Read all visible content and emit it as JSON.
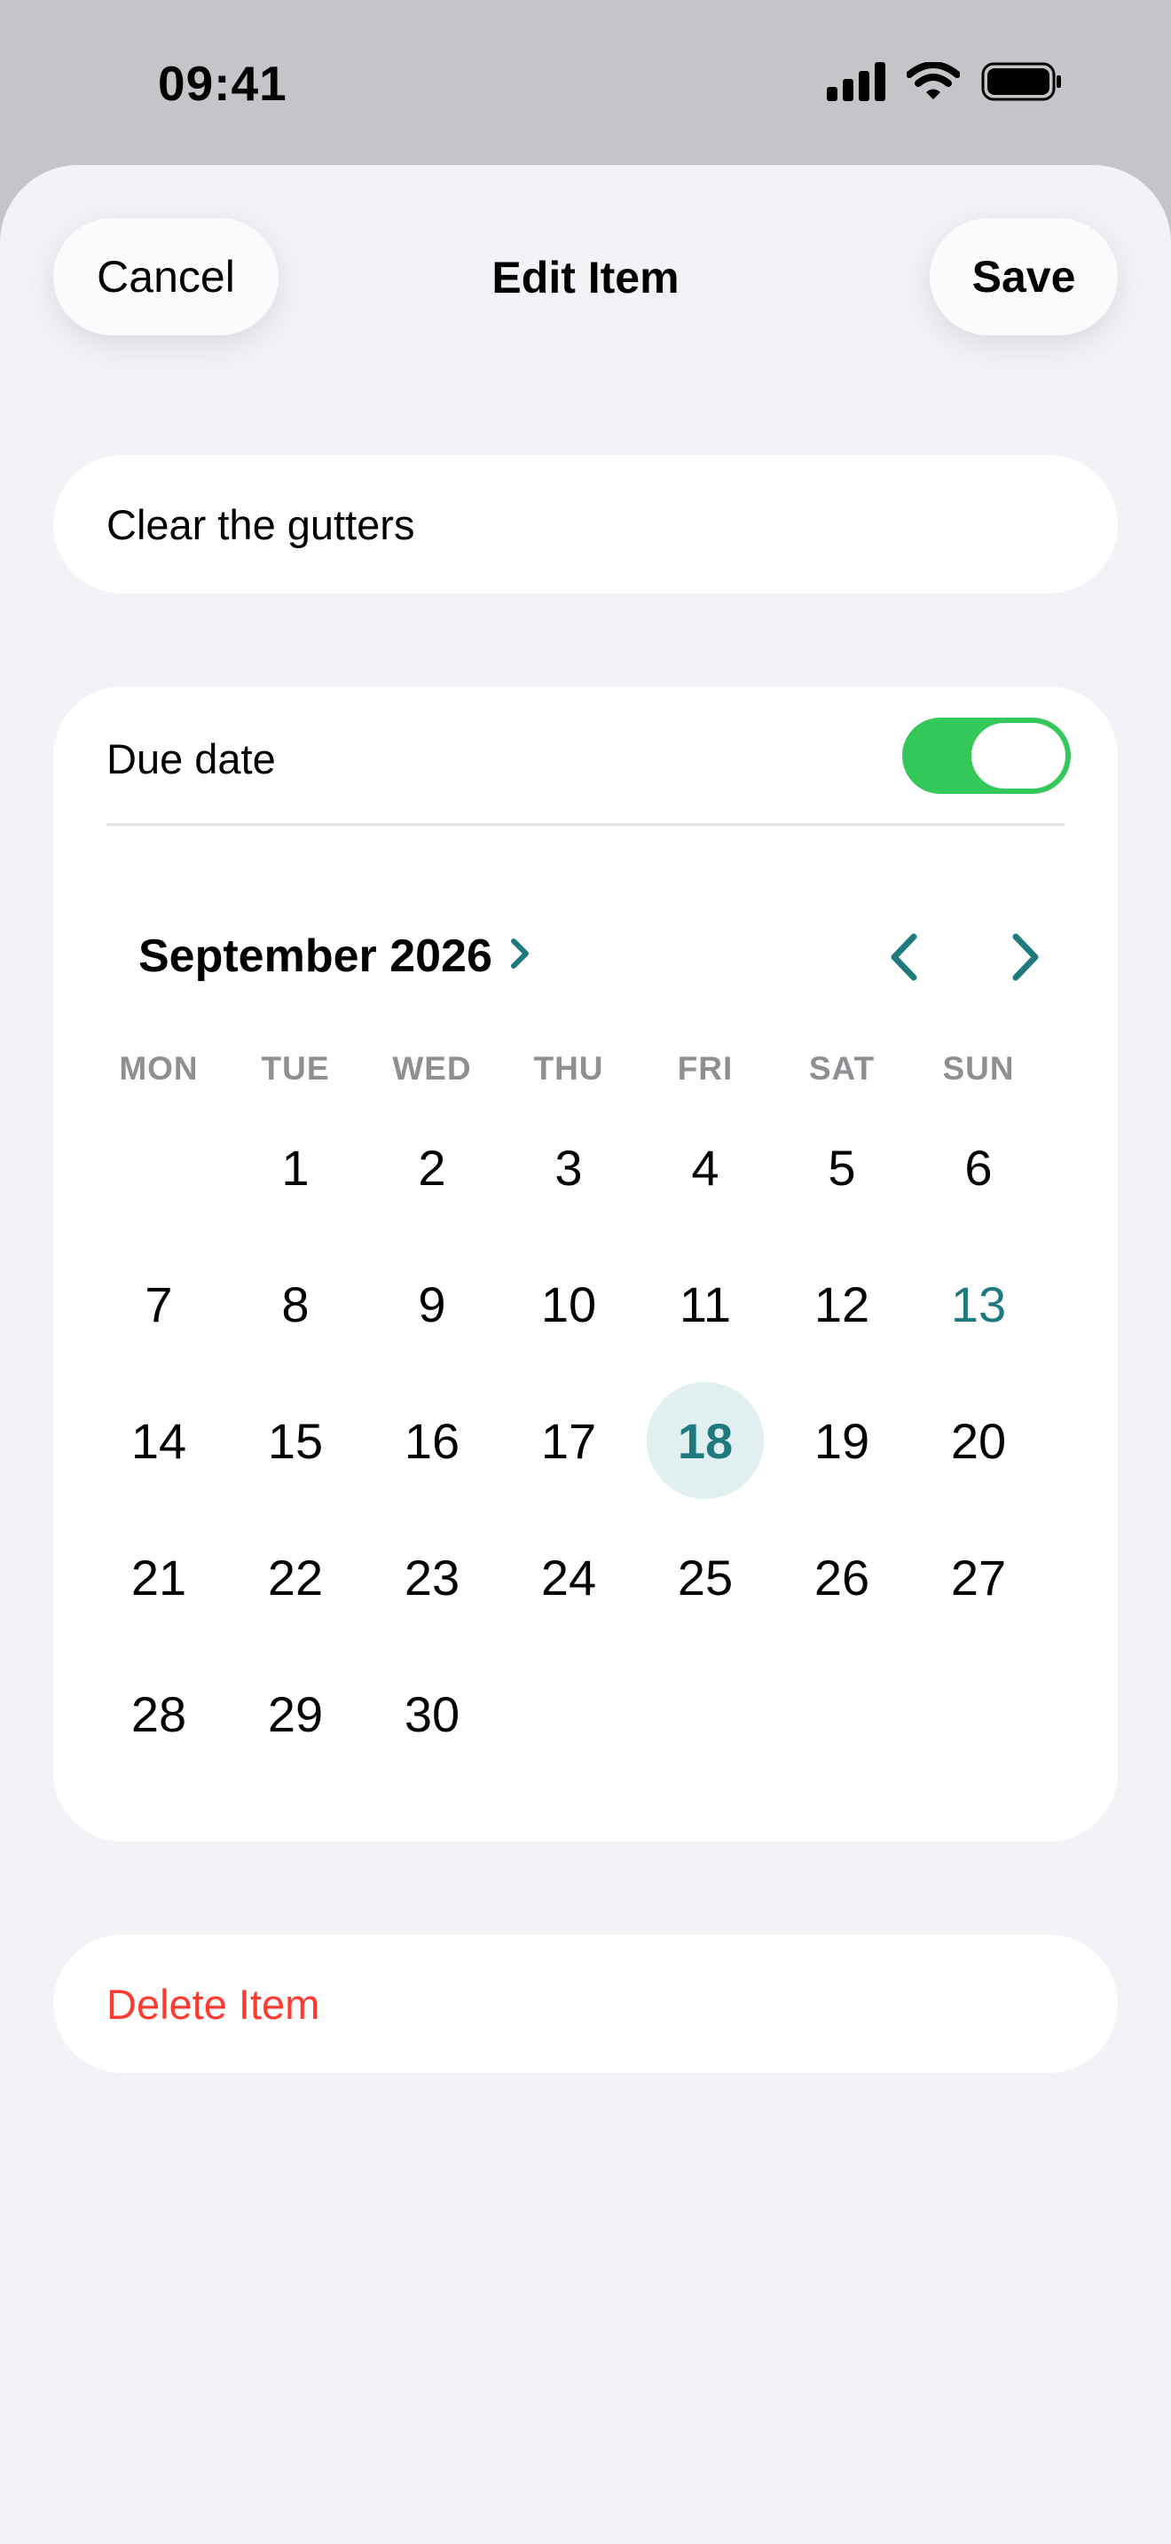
{
  "status_bar": {
    "time": "09:41",
    "icons": [
      "cellular-signal-icon",
      "wifi-icon",
      "battery-icon"
    ]
  },
  "nav": {
    "cancel_label": "Cancel",
    "title": "Edit Item",
    "save_label": "Save"
  },
  "item": {
    "title_value": "Clear the gutters"
  },
  "due_date": {
    "label": "Due date",
    "enabled": true
  },
  "calendar": {
    "month_title": "September 2026",
    "weekdays": [
      "MON",
      "TUE",
      "WED",
      "THU",
      "FRI",
      "SAT",
      "SUN"
    ],
    "leading_blanks": 1,
    "days": [
      "1",
      "2",
      "3",
      "4",
      "5",
      "6",
      "7",
      "8",
      "9",
      "10",
      "11",
      "12",
      "13",
      "14",
      "15",
      "16",
      "17",
      "18",
      "19",
      "20",
      "21",
      "22",
      "23",
      "24",
      "25",
      "26",
      "27",
      "28",
      "29",
      "30"
    ],
    "today": "13",
    "selected": "18"
  },
  "actions": {
    "delete_label": "Delete Item"
  },
  "colors": {
    "accent": "#1f7a80",
    "toggle_on": "#34c759",
    "destructive": "#ff3b30",
    "selected_bg": "#e1eff0"
  }
}
